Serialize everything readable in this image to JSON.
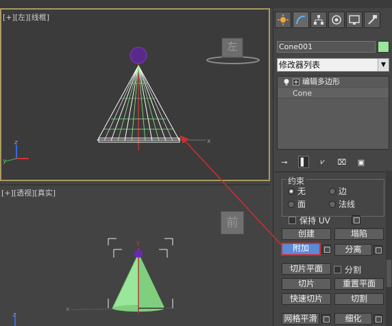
{
  "viewport_top": {
    "label_parts": [
      "[+]",
      "[左]",
      "[线框]"
    ],
    "viewcube_label": "左",
    "axis_labels": {
      "x": "x",
      "y": "y",
      "z": "z"
    }
  },
  "viewport_bottom": {
    "label_parts": [
      "[+]",
      "[透视]",
      "[真实]"
    ],
    "viewcube_label": "前",
    "axis_labels": {
      "x": "x",
      "y": "y",
      "z": "z"
    }
  },
  "panel": {
    "tabs": [
      "create-icon",
      "modify-icon",
      "hierarchy-icon",
      "motion-icon",
      "display-icon",
      "utilities-icon"
    ],
    "object_name": "Cone001",
    "object_color": "#9ae69a",
    "modifier_list": "修改器列表",
    "stack": [
      {
        "label": "编辑多边形"
      },
      {
        "label": "Cone"
      }
    ],
    "selection": {
      "title": "约束",
      "options": [
        "无",
        "边",
        "面",
        "法线"
      ],
      "selected": "无"
    },
    "preserve_uv": "保持 UV",
    "buttons": {
      "create": "创建",
      "collapse": "塌陷",
      "attach": "附加",
      "detach": "分离",
      "slice_plane": "切片平面",
      "split": "分割",
      "slice": "切片",
      "reset_plane": "重置平面",
      "quickslice": "快速切片",
      "cut": "切割",
      "meshsmooth": "网格平滑",
      "tessellate": "细化"
    }
  },
  "colors": {
    "highlight_button": "#5b8ad6",
    "annotation_red": "#d22d2d",
    "active_viewport_border": "#a99a62"
  }
}
